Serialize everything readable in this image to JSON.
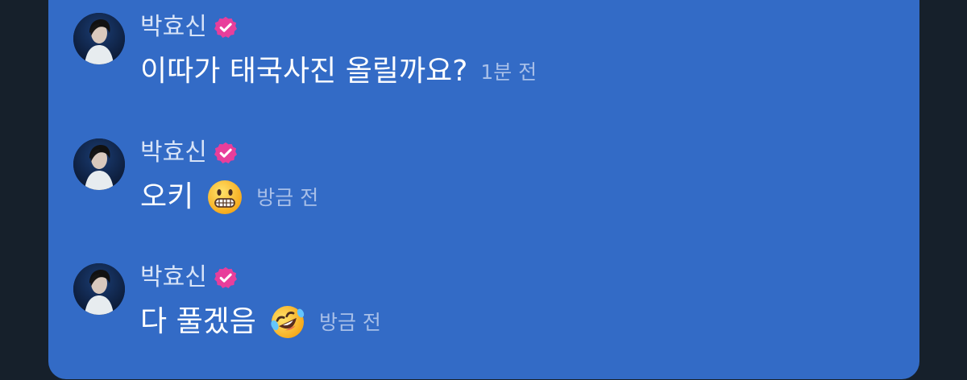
{
  "messages": [
    {
      "sender": "박효신",
      "text": "이따가 태국사진 올릴까요?",
      "time": "1분 전",
      "emoji": ""
    },
    {
      "sender": "박효신",
      "text": "오키",
      "time": "방금 전",
      "emoji": "grimacing-face"
    },
    {
      "sender": "박효신",
      "text": "다 풀겠음",
      "time": "방금 전",
      "emoji": "rolling-on-the-floor-laughing"
    }
  ],
  "colors": {
    "page_background": "#16202b",
    "panel_background": "#336bc6",
    "verified_badge": "#e83e9b",
    "sender_text": "#d7e3f7",
    "message_text": "#ffffff",
    "time_text": "#a8bfe8"
  },
  "icons": {
    "verified": "verified-badge-icon",
    "emoji_1": "grimacing-face-icon",
    "emoji_2": "rolling-on-the-floor-laughing-icon"
  }
}
